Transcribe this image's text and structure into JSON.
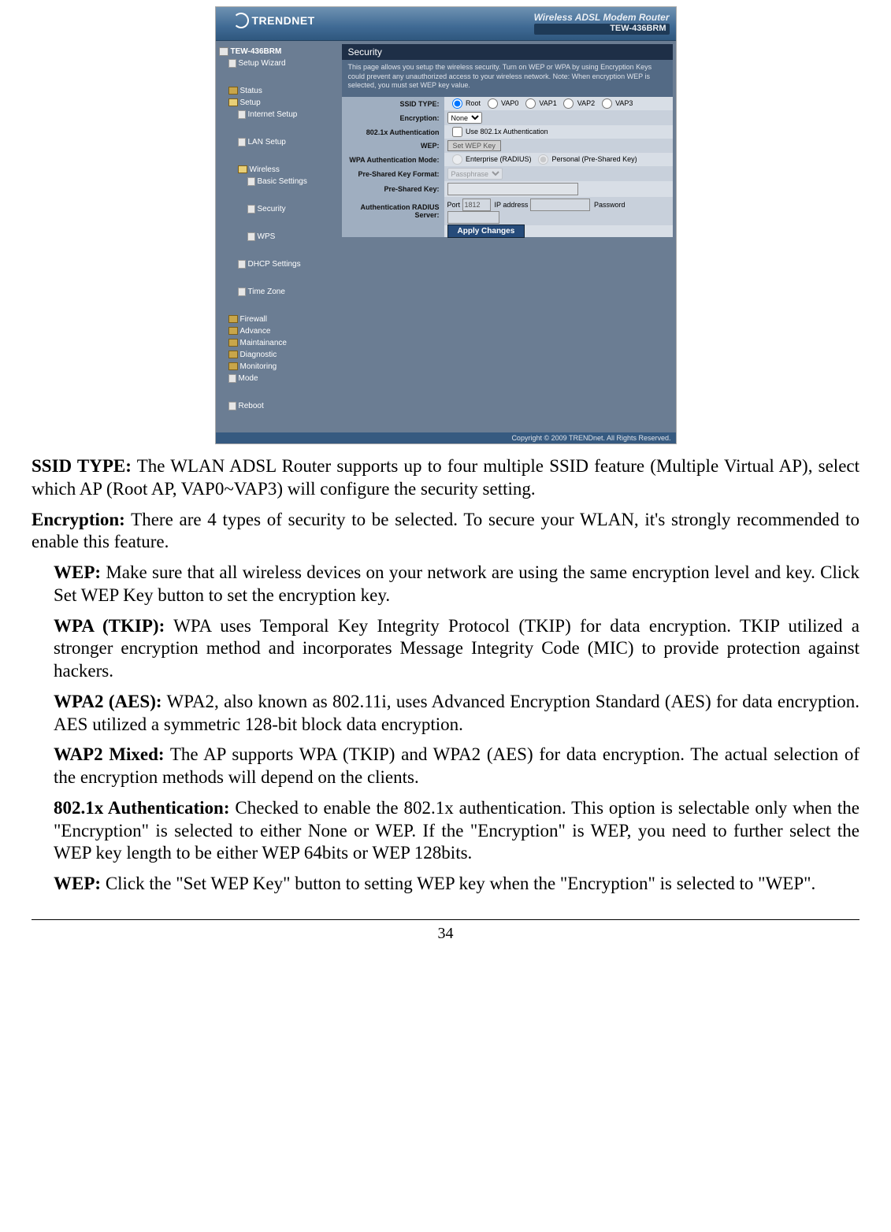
{
  "screenshot": {
    "brand": "TRENDNET",
    "product_line": "Wireless ADSL Modem Router",
    "product_model": "TEW-436BRM",
    "copyright": "Copyright © 2009 TRENDnet. All Rights Reserved.",
    "panel": {
      "title": "Security",
      "intro": "This page allows you setup the wireless security. Turn on WEP or WPA by using Encryption Keys could prevent any unauthorized access to your wireless network. Note: When encryption WEP is selected, you must set WEP key value.",
      "rows": {
        "ssid_type_label": "SSID TYPE:",
        "ssid_type_opts": [
          "Root",
          "VAP0",
          "VAP1",
          "VAP2",
          "VAP3"
        ],
        "encryption_label": "Encryption:",
        "encryption_value": "None",
        "auth_label": "802.1x Authentication",
        "auth_checkbox": "Use 802.1x Authentication",
        "wep_label": "WEP:",
        "wep_btn": "Set WEP Key",
        "wpa_mode_label": "WPA Authentication Mode:",
        "wpa_mode_opts": [
          "Enterprise (RADIUS)",
          "Personal (Pre-Shared Key)"
        ],
        "psk_fmt_label": "Pre-Shared Key Format:",
        "psk_fmt_value": "Passphrase",
        "psk_label": "Pre-Shared Key:",
        "radius_label": "Authentication RADIUS Server:",
        "radius_port_label": "Port",
        "radius_port": "1812",
        "radius_ip_label": "IP address",
        "radius_pw_label": "Password",
        "apply": "Apply Changes"
      }
    },
    "tree": {
      "root": "TEW-436BRM",
      "items": [
        {
          "t": "Setup Wizard",
          "lvl": 1,
          "cls": "page"
        },
        {
          "t": "Status",
          "lvl": 1,
          "cls": ""
        },
        {
          "t": "Setup",
          "lvl": 1,
          "cls": "open"
        },
        {
          "t": "Internet Setup",
          "lvl": 2,
          "cls": "page"
        },
        {
          "t": "LAN Setup",
          "lvl": 2,
          "cls": "page"
        },
        {
          "t": "Wireless",
          "lvl": 2,
          "cls": "open"
        },
        {
          "t": "Basic Settings",
          "lvl": 3,
          "cls": "page"
        },
        {
          "t": "Security",
          "lvl": 3,
          "cls": "page"
        },
        {
          "t": "WPS",
          "lvl": 3,
          "cls": "page"
        },
        {
          "t": "DHCP Settings",
          "lvl": 2,
          "cls": "page"
        },
        {
          "t": "Time Zone",
          "lvl": 2,
          "cls": "page"
        },
        {
          "t": "Firewall",
          "lvl": 1,
          "cls": ""
        },
        {
          "t": "Advance",
          "lvl": 1,
          "cls": ""
        },
        {
          "t": "Maintainance",
          "lvl": 1,
          "cls": ""
        },
        {
          "t": "Diagnostic",
          "lvl": 1,
          "cls": ""
        },
        {
          "t": "Monitoring",
          "lvl": 1,
          "cls": ""
        },
        {
          "t": "Mode",
          "lvl": 1,
          "cls": "page"
        },
        {
          "t": "Reboot",
          "lvl": 1,
          "cls": "page"
        }
      ]
    }
  },
  "doc": {
    "p1_b": "SSID TYPE:",
    "p1": "  The WLAN ADSL Router supports up to four multiple SSID feature (Multiple Virtual AP), select which AP (Root AP, VAP0~VAP3) will configure the security setting.",
    "p2_b": "Encryption:",
    "p2": "  There are 4 types of security to be selected. To secure your WLAN, it's strongly recommended to enable this feature.",
    "p3_b": "WEP:",
    "p3": " Make sure that all wireless devices on your network are using the same encryption level and key. Click Set WEP Key button to set the encryption key.",
    "p4_b": "WPA (TKIP):",
    "p4": " WPA uses Temporal Key Integrity Protocol (TKIP) for data encryption. TKIP utilized a stronger encryption method and incorporates Message Integrity Code (MIC) to provide protection against hackers.",
    "p5_b": "WPA2 (AES):",
    "p5": " WPA2, also known as 802.11i, uses Advanced Encryption Standard (AES) for data encryption. AES utilized a symmetric 128-bit block data encryption.",
    "p6_b": "WAP2 Mixed:",
    "p6": " The AP supports WPA (TKIP) and WPA2 (AES) for data encryption. The actual selection of the encryption methods will depend on the clients.",
    "p7_b": "802.1x Authentication:",
    "p7": "  Checked to enable the 802.1x authentication. This option is selectable only when the \"Encryption\" is selected to either None or WEP. If the \"Encryption\" is WEP, you need to further select the WEP key length to be either WEP 64bits or WEP 128bits.",
    "p8_b": "WEP:",
    "p8": " Click the \"Set WEP Key\" button to setting WEP key when the \"Encryption\" is selected to \"WEP\".",
    "page_num": "34"
  }
}
